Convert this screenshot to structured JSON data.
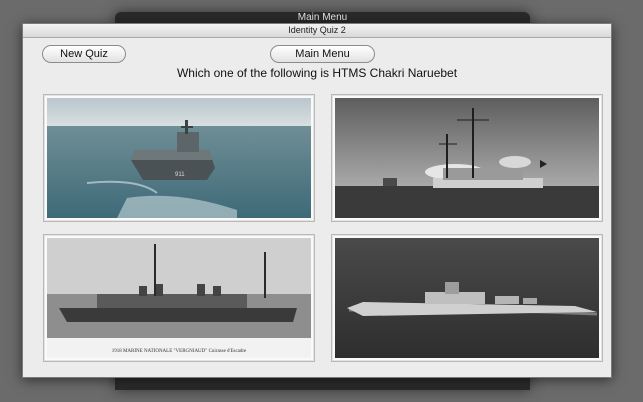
{
  "background_window": {
    "title": "Main Menu"
  },
  "window": {
    "title": "Identity Quiz 2"
  },
  "toolbar": {
    "new_quiz_label": "New Quiz",
    "main_menu_label": "Main Menu"
  },
  "question": "Which one of the following is HTMS Chakri Naruebet",
  "choices": [
    {
      "caption": "",
      "icon": "aircraft-carrier-photo"
    },
    {
      "caption": "",
      "icon": "sailing-warship-photo"
    },
    {
      "caption": "1918 MARINE NATIONALE \"VERGNIAUD\" Cuirasse d'Escadre",
      "icon": "french-battleship-postcard"
    },
    {
      "caption": "",
      "icon": "cruiser-aerial-photo"
    }
  ]
}
